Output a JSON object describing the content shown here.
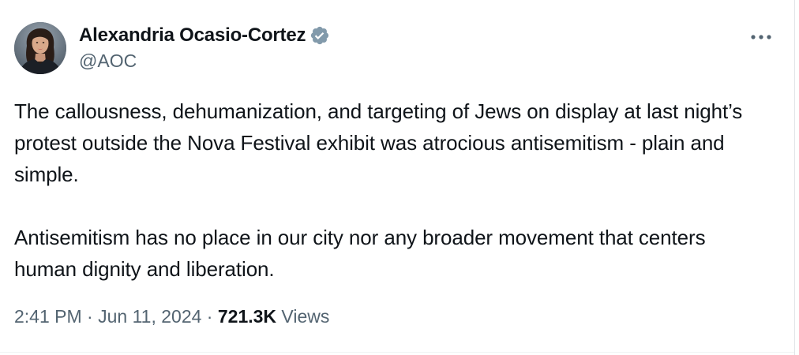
{
  "tweet": {
    "author": {
      "display_name": "Alexandria Ocasio-Cortez",
      "handle": "@AOC",
      "verified": true,
      "verified_icon": "verified-badge-icon",
      "verified_color": "#829aab",
      "avatar_icon": "avatar-photo"
    },
    "more_icon": "more-horizontal-icon",
    "paragraphs": [
      "The callousness, dehumanization, and targeting of Jews on display at last night’s protest outside the Nova Festival exhibit was atrocious antisemitism - plain and simple.",
      "Antisemitism has no place in our city nor any broader movement that centers human dignity and liberation."
    ],
    "meta": {
      "time": "2:41 PM",
      "separator": "·",
      "date": "Jun 11, 2024",
      "views_count": "721.3K",
      "views_label": "Views"
    }
  },
  "colors": {
    "text_primary": "#0f1419",
    "text_secondary": "#536471",
    "background": "#ffffff"
  }
}
